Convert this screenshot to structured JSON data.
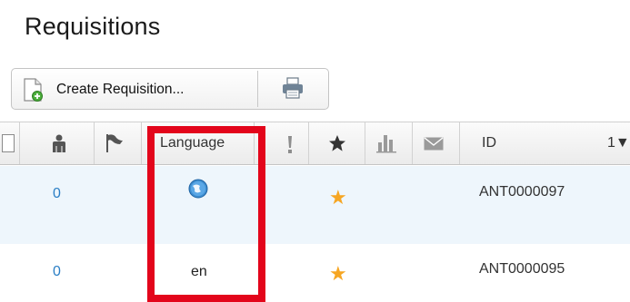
{
  "page": {
    "title": "Requisitions"
  },
  "toolbar": {
    "create_label": "Create Requisition...",
    "create_icon": "new-document-icon",
    "print_icon": "printer-icon"
  },
  "grid": {
    "columns": [
      {
        "icon": "checkbox-icon"
      },
      {
        "icon": "person-icon"
      },
      {
        "icon": "flag-icon"
      },
      {
        "label": "Language"
      },
      {
        "icon": "exclamation-icon"
      },
      {
        "icon": "star-icon"
      },
      {
        "icon": "bar-chart-icon"
      },
      {
        "icon": "envelope-icon"
      },
      {
        "label": "ID"
      },
      {
        "label": "1▼"
      }
    ],
    "rows": [
      {
        "count": "0",
        "language_icon": "globe-icon",
        "starred": "★",
        "id": "ANT0000097"
      },
      {
        "count": "0",
        "language": "en",
        "starred": "★",
        "id": "ANT0000095"
      }
    ]
  },
  "colors": {
    "highlight": "#e3051b",
    "star": "#f6a623",
    "link": "#2a7ec5",
    "selected_row": "#eef6fc"
  }
}
